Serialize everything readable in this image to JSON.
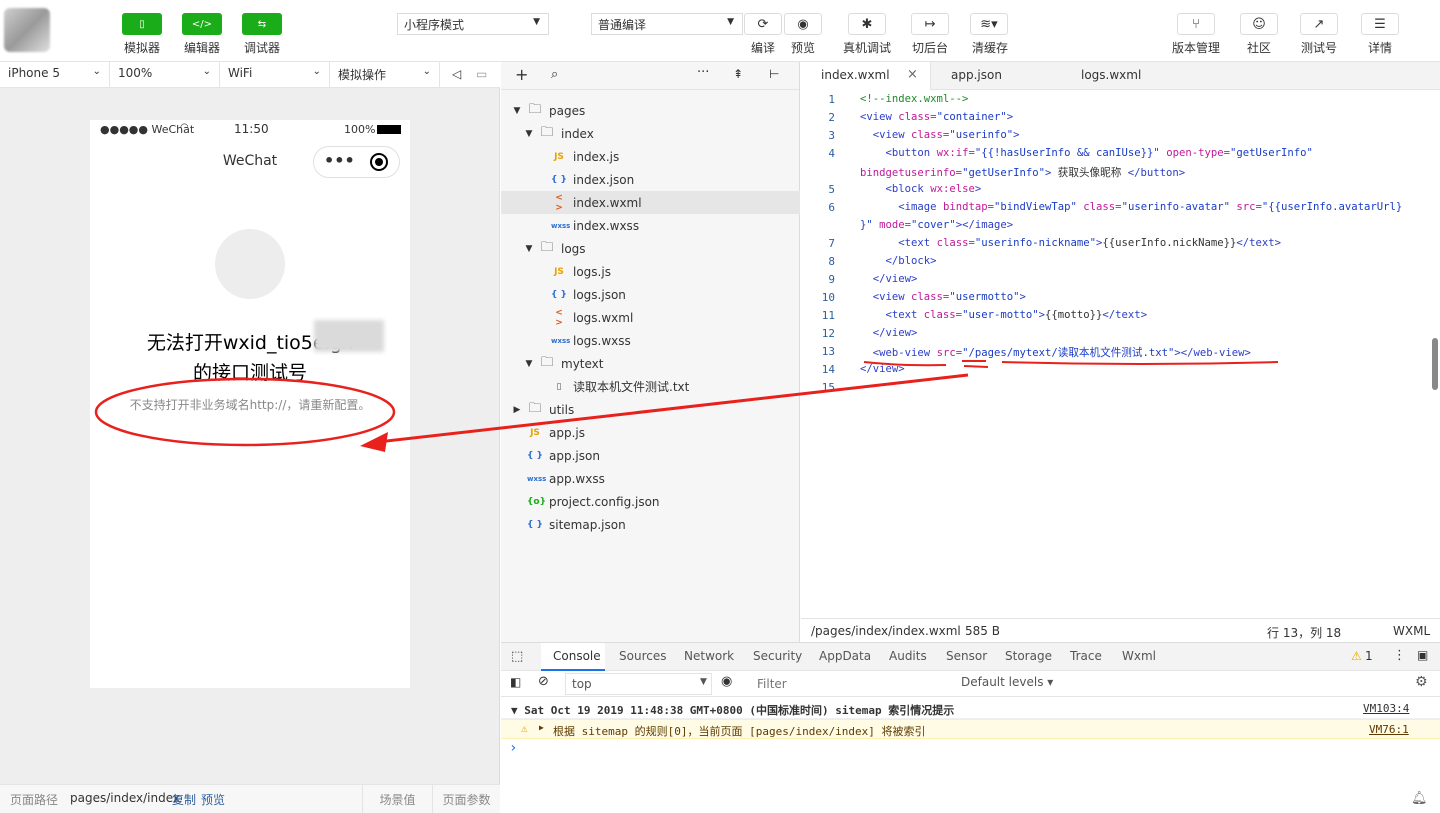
{
  "toolbar": {
    "left_buttons": [
      {
        "label": "模拟器",
        "icon": "phone-icon"
      },
      {
        "label": "编辑器",
        "icon": "code-icon"
      },
      {
        "label": "调试器",
        "icon": "debug-icon"
      }
    ],
    "mode_select": "小程序模式",
    "compile_select": "普通编译",
    "actions": [
      {
        "label": "编译",
        "icon": "refresh-icon"
      },
      {
        "label": "预览",
        "icon": "eye-icon"
      },
      {
        "label": "真机调试",
        "icon": "bug-icon"
      },
      {
        "label": "切后台",
        "icon": "switch-icon"
      },
      {
        "label": "清缓存",
        "icon": "layers-icon"
      }
    ],
    "right_actions": [
      {
        "label": "版本管理",
        "icon": "branch-icon"
      },
      {
        "label": "社区",
        "icon": "chat-icon"
      },
      {
        "label": "测试号",
        "icon": "external-icon"
      },
      {
        "label": "详情",
        "icon": "menu-icon"
      }
    ]
  },
  "simulator_bar": {
    "device": "iPhone 5",
    "zoom": "100%",
    "network": "WiFi",
    "operation": "模拟操作"
  },
  "phone": {
    "carrier": "●●●●● WeChat",
    "time": "11:50",
    "battery": "100%",
    "nav_title": "WeChat",
    "error_line1": "无法打开wxid_tio5elgx",
    "error_line2": "的接口测试号",
    "error_detail": "不支持打开非业务域名http://，请重新配置。"
  },
  "sim_footer": {
    "path_label": "页面路径",
    "path": "pages/index/index",
    "copy": "复制",
    "preview": "预览",
    "scene": "场景值",
    "params": "页面参数"
  },
  "explorer": {
    "items": [
      {
        "name": "pages",
        "type": "folder",
        "depth": 0,
        "open": true
      },
      {
        "name": "index",
        "type": "folder",
        "depth": 1,
        "open": true
      },
      {
        "name": "index.js",
        "type": "js",
        "depth": 2
      },
      {
        "name": "index.json",
        "type": "json",
        "depth": 2
      },
      {
        "name": "index.wxml",
        "type": "wxml",
        "depth": 2,
        "active": true
      },
      {
        "name": "index.wxss",
        "type": "wxss",
        "depth": 2
      },
      {
        "name": "logs",
        "type": "folder",
        "depth": 1,
        "open": true
      },
      {
        "name": "logs.js",
        "type": "js",
        "depth": 2
      },
      {
        "name": "logs.json",
        "type": "json",
        "depth": 2
      },
      {
        "name": "logs.wxml",
        "type": "wxml",
        "depth": 2
      },
      {
        "name": "logs.wxss",
        "type": "wxss",
        "depth": 2
      },
      {
        "name": "mytext",
        "type": "folder",
        "depth": 1,
        "open": true
      },
      {
        "name": "读取本机文件测试.txt",
        "type": "txt",
        "depth": 2
      },
      {
        "name": "utils",
        "type": "folder",
        "depth": 0,
        "open": false
      },
      {
        "name": "app.js",
        "type": "js",
        "depth": 0
      },
      {
        "name": "app.json",
        "type": "json",
        "depth": 0
      },
      {
        "name": "app.wxss",
        "type": "wxss",
        "depth": 0
      },
      {
        "name": "project.config.json",
        "type": "config",
        "depth": 0
      },
      {
        "name": "sitemap.json",
        "type": "json",
        "depth": 0
      }
    ],
    "icon_text": {
      "js": "JS",
      "json": "{ }",
      "wxml": "< >",
      "wxss": "wxss",
      "txt": "▯",
      "config": "{o}"
    }
  },
  "editor": {
    "tabs": [
      "index.wxml",
      "app.json",
      "logs.wxml"
    ],
    "line_numbers": [
      "1",
      "2",
      "3",
      "4",
      "",
      "5",
      "6",
      "",
      "7",
      "8",
      "9",
      "10",
      "11",
      "12",
      "13",
      "14",
      "15"
    ],
    "status": {
      "path": "/pages/index/index.wxml",
      "size": "585 B",
      "position": "行 13，列 18",
      "lang": "WXML"
    }
  },
  "console": {
    "tabs": [
      "Console",
      "Sources",
      "Network",
      "Security",
      "AppData",
      "Audits",
      "Sensor",
      "Storage",
      "Trace",
      "Wxml"
    ],
    "warn_count": "1",
    "context": "top",
    "filter_placeholder": "Filter",
    "levels": "Default levels",
    "log1": "▼ Sat Oct 19 2019 11:48:38 GMT+0800 (中国标准时间) sitemap 索引情况提示",
    "log1_src": "VM103:4",
    "log2": "根据 sitemap 的规则[0]，当前页面 [pages/index/index] 将被索引",
    "log2_src": "VM76:1",
    "prompt": "›"
  },
  "colors": {
    "green": "#1aad19",
    "red": "#e8211c",
    "warn_bg": "#fffbe5"
  }
}
